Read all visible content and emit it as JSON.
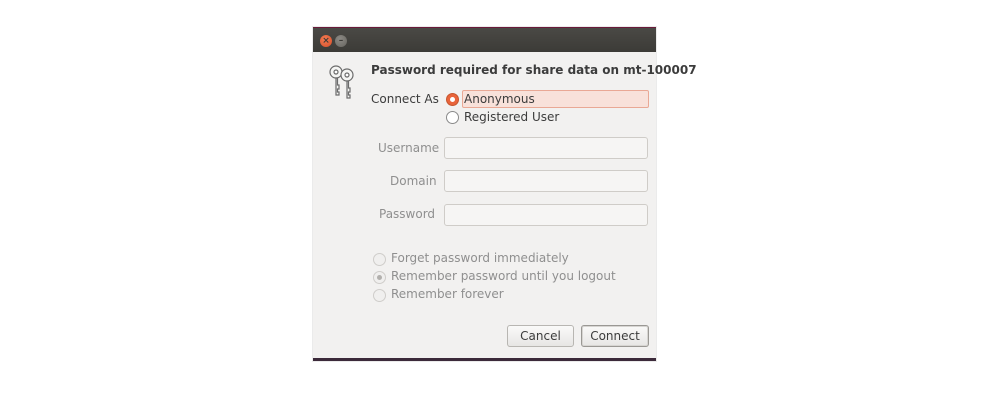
{
  "window": {
    "close_glyph": "×",
    "minimize_glyph": "–"
  },
  "dialog": {
    "icon": "keys-icon",
    "heading": "Password required for share data on mt-100007",
    "connect_as_label": "Connect As",
    "connect_as_options": [
      {
        "label": "Anonymous",
        "selected": true
      },
      {
        "label": "Registered User",
        "selected": false
      }
    ],
    "fields": {
      "username_label": "Username",
      "username_value": "",
      "domain_label": "Domain",
      "domain_value": "",
      "password_label": "Password",
      "password_value": ""
    },
    "remember_options": [
      {
        "label": "Forget password immediately",
        "selected": false
      },
      {
        "label": "Remember password until you logout",
        "selected": true
      },
      {
        "label": "Remember forever",
        "selected": false
      }
    ],
    "buttons": {
      "cancel": "Cancel",
      "connect": "Connect"
    }
  },
  "colors": {
    "accent": "#e9643b",
    "titlebar": "#3c3b37",
    "dialog_bg": "#f2f1f0"
  }
}
